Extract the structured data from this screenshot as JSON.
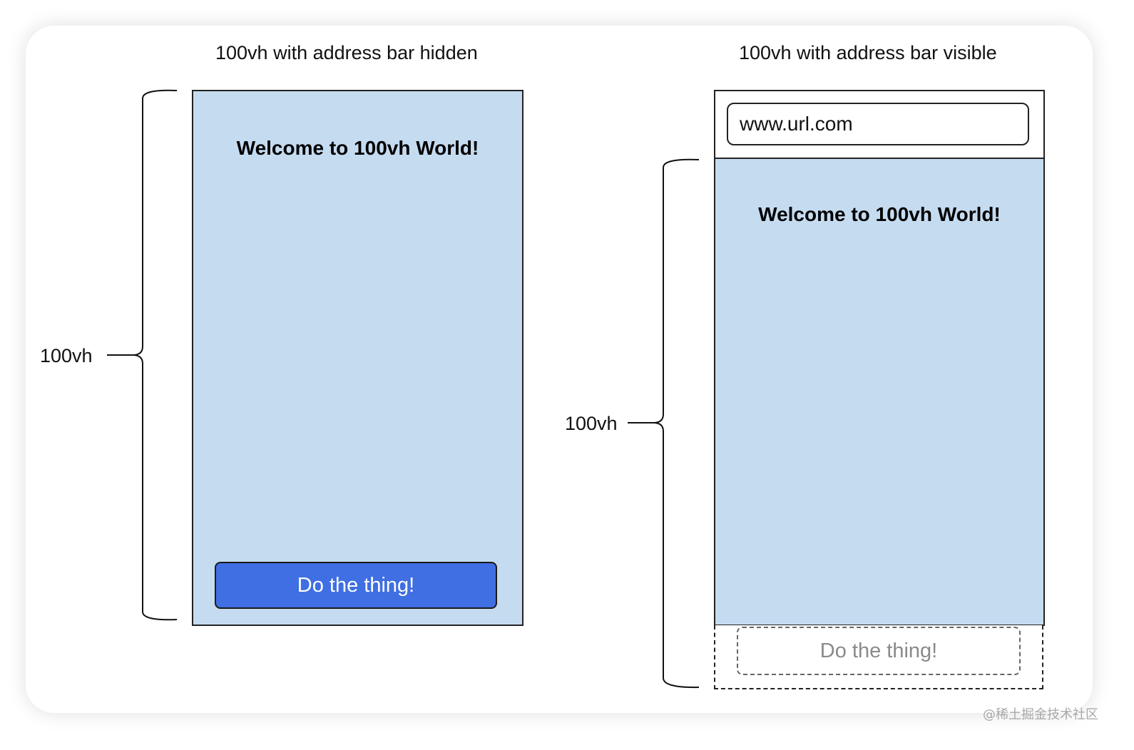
{
  "left_panel": {
    "caption": "100vh with address bar hidden",
    "heading": "Welcome to 100vh World!",
    "button_label": "Do the thing!",
    "vh_label": "100vh"
  },
  "right_panel": {
    "caption": "100vh with address bar visible",
    "url": "www.url.com",
    "heading": "Welcome to 100vh World!",
    "button_label": "Do the thing!",
    "vh_label": "100vh"
  },
  "watermark": "@稀土掘金技术社区",
  "colors": {
    "viewport_fill": "#c5dbf0",
    "button_fill": "#3f6fe3",
    "ghost_button_text": "#8a8a8a",
    "border": "#222222"
  }
}
